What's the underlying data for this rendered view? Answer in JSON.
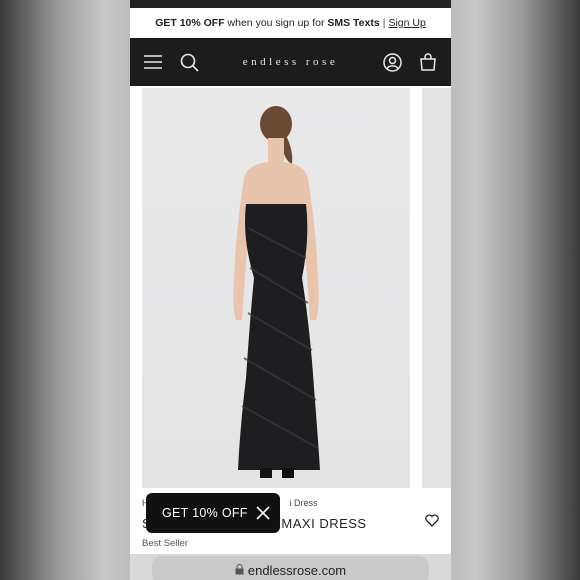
{
  "promo_banner": {
    "offer": "GET 10% OFF",
    "text": "when you sign up for",
    "channel": "SMS Texts",
    "separator": "|",
    "link": "Sign Up"
  },
  "header": {
    "logo": "endless rose",
    "icons": [
      "menu-icon",
      "search-icon",
      "account-icon",
      "bag-icon"
    ]
  },
  "product": {
    "breadcrumb_start": "H",
    "breadcrumb_end": "i Dress",
    "title_start": "S",
    "title_end": "MAXI DRESS",
    "badge": "Best Seller"
  },
  "toast": {
    "label": "GET 10% OFF"
  },
  "browser": {
    "url": "endlessrose.com"
  },
  "colors": {
    "header_bg": "#1c1c1c",
    "toast_bg": "#111111",
    "photo_bg": "#e7e7e8"
  }
}
